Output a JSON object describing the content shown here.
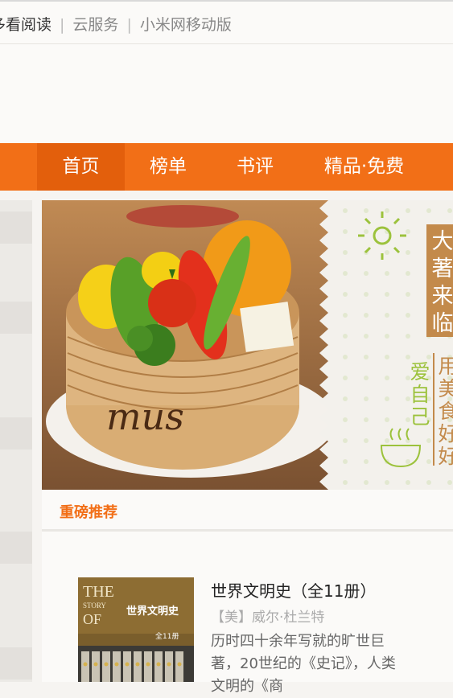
{
  "top_links": {
    "duokan": "多看阅读",
    "cloud": "云服务",
    "mobile": "小米网移动版",
    "separator": "|"
  },
  "nav": {
    "items": [
      {
        "label": "首页",
        "active": true
      },
      {
        "label": "榜单",
        "active": false
      },
      {
        "label": "书评",
        "active": false
      },
      {
        "label": "精品·免费",
        "active": false
      }
    ],
    "color": "#f26f17",
    "active_color": "#e35f0c"
  },
  "banner": {
    "vertical_title": "大著来临",
    "vertical_sub": "爱自己",
    "vertical_sub2": "用美食好好",
    "steamer_text": "mus"
  },
  "section": {
    "title": "重磅推荐"
  },
  "book": {
    "title": "世界文明史（全11册）",
    "author": "【美】威尔·杜兰特",
    "description": "历时四十余年写就的旷世巨著，20世纪的《史记》，人类文明的《商",
    "cover_text_en": "THE STORY OF CIVILIZATION",
    "cover_text_cn": "世界文明史",
    "cover_badge": "全11册"
  }
}
